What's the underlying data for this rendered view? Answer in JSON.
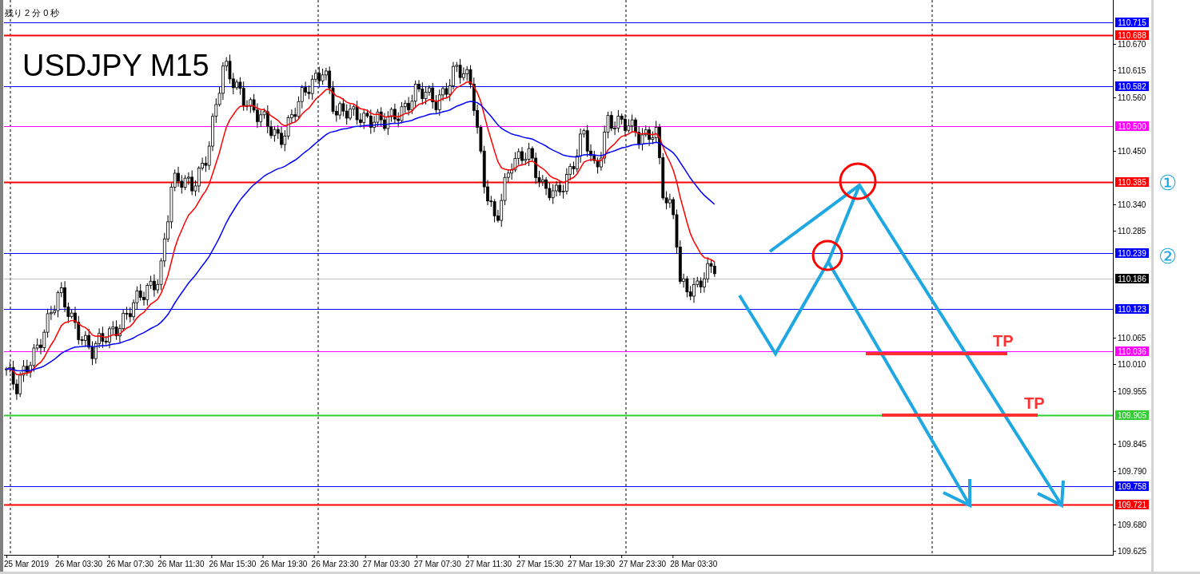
{
  "status_text": "残り 2 分 0 秒",
  "symbol_label": "USDJPY M15",
  "price_levels": [
    {
      "price": "110.715",
      "color": "#0000ff",
      "kind": "thin"
    },
    {
      "price": "110.688",
      "color": "#ff0000",
      "kind": "thick"
    },
    {
      "price": "110.582",
      "color": "#0000ff",
      "kind": "thin"
    },
    {
      "price": "110.500",
      "color": "#ff00ff",
      "kind": "thin"
    },
    {
      "price": "110.385",
      "color": "#ff0000",
      "kind": "thick"
    },
    {
      "price": "110.239",
      "color": "#0000ff",
      "kind": "thin"
    },
    {
      "price": "110.186",
      "color": "#000000",
      "kind": "current"
    },
    {
      "price": "110.123",
      "color": "#0000ff",
      "kind": "thin"
    },
    {
      "price": "110.036",
      "color": "#ff00ff",
      "kind": "thin"
    },
    {
      "price": "109.905",
      "color": "#32cd32",
      "kind": "thick"
    },
    {
      "price": "109.758",
      "color": "#0000ff",
      "kind": "thin"
    },
    {
      "price": "109.721",
      "color": "#ff0000",
      "kind": "thick"
    }
  ],
  "price_ticks": [
    "110.670",
    "110.615",
    "110.560",
    "110.450",
    "110.340",
    "110.285",
    "110.065",
    "110.010",
    "109.955",
    "109.845",
    "109.790",
    "109.680",
    "109.625"
  ],
  "time_labels": [
    "25 Mar 2019",
    "26 Mar 03:30",
    "26 Mar 07:30",
    "26 Mar 11:30",
    "26 Mar 15:30",
    "26 Mar 19:30",
    "26 Mar 23:30",
    "27 Mar 03:30",
    "27 Mar 07:30",
    "27 Mar 11:30",
    "27 Mar 15:30",
    "27 Mar 19:30",
    "27 Mar 23:30",
    "28 Mar 03:30"
  ],
  "tp_labels": [
    "TP",
    "TP"
  ],
  "markers": [
    {
      "label": "①"
    },
    {
      "label": "②"
    }
  ]
}
